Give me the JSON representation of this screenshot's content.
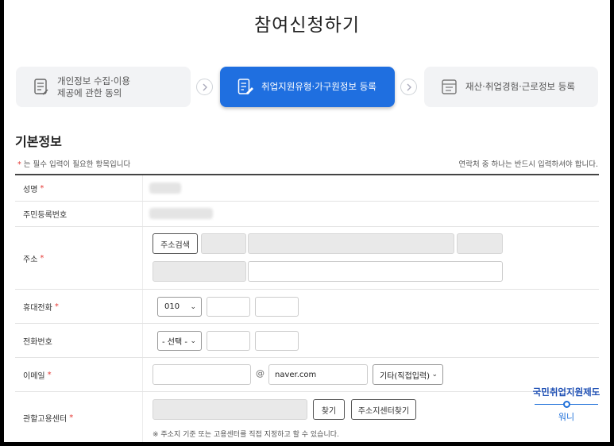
{
  "page": {
    "title": "참여신청하기"
  },
  "steps": [
    {
      "label": "개인정보 수집·이용\n제공에 관한 동의",
      "icon": "document-icon",
      "active": false
    },
    {
      "label": "취업지원유형·가구원정보 등록",
      "icon": "edit-document-icon",
      "active": true
    },
    {
      "label": "재산·취업경험·근로정보 등록",
      "icon": "browser-window-icon",
      "active": false
    }
  ],
  "section": {
    "title": "기본정보",
    "required_note_star": "*",
    "required_note": " 는 필수 입력이 필요한 항목입니다",
    "contact_note": "연락처 중 하나는 반드시 입력하셔야 합니다."
  },
  "form": {
    "name_label": "성명",
    "rrn_label": "주민등록번호",
    "address_label": "주소",
    "address_search_button": "주소검색",
    "mobile_label": "휴대전화",
    "mobile_prefix": "010",
    "phone_label": "전화번호",
    "phone_prefix": "- 선택 -",
    "email_label": "이메일",
    "email_at": "@",
    "email_domain": "naver.com",
    "email_domain_select": "기타(직접입력)",
    "center_label": "관할고용센터",
    "center_find_button": "찾기",
    "center_address_button": "주소지센터찾기",
    "center_hint": "※ 주소지 기준 또는 고용센터를 직접 지정하고 할 수 있습니다."
  },
  "logo": {
    "line1": "국민취업지원제도",
    "line2": "워니"
  },
  "colors": {
    "accent": "#1f6fe0",
    "required": "#e53935",
    "brand": "#1e4fb4"
  }
}
